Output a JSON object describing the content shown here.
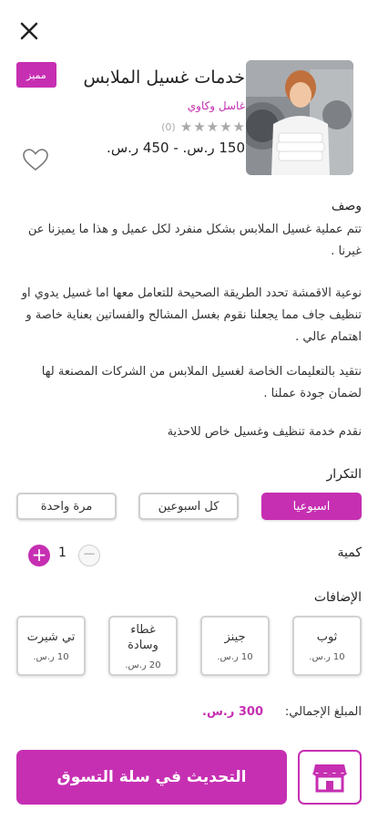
{
  "header": {
    "close_icon": "close-icon",
    "featured_badge": "مميز",
    "title": "خدمات غسيل الملابس",
    "provider": "غاسل وكاوي",
    "rating": {
      "value": 0,
      "max": 5,
      "count_label": "(0)"
    },
    "price_range": "150 ر.س. - 450 ر.س.",
    "favorite_icon": "heart-outline-icon"
  },
  "description": {
    "title": "وصف",
    "paragraphs": [
      "تتم عملية غسيل الملابس بشكل منفرد لكل عميل و هذا ما يميزنا عن غيرنا .",
      "نوعية الاقمشة تحدد الطريقة الصحيحة للتعامل معها اما غسيل يدوي او تنظيف جاف مما يجعلنا نقوم بغسل المشالح والفساتين بعناية خاصة و اهتمام عالي .",
      "نتقيد بالتعليمات الخاصة لغسيل الملابس من الشركات المصنعة لها لضمان جودة عملنا .",
      "نقدم خدمة تنظيف وغسيل خاص للاحذية"
    ]
  },
  "frequency": {
    "title": "التكرار",
    "options": [
      "اسبوعيا",
      "كل اسبوعين",
      "مرة واحدة"
    ],
    "selected": "اسبوعيا"
  },
  "quantity": {
    "title": "كمية",
    "value": "1",
    "plus": "+",
    "minus": "−"
  },
  "addons": {
    "title": "الإضافات",
    "items": [
      {
        "name": "ثوب",
        "price": "10 ر.س."
      },
      {
        "name": "جينز",
        "price": "10 ر.س."
      },
      {
        "name": "غطاء وسادة",
        "price": "20 ر.س."
      },
      {
        "name": "تي شيرت",
        "price": "10 ر.س."
      }
    ]
  },
  "total": {
    "label": "المبلغ الإجمالي:",
    "value": "300 ر.س."
  },
  "footer": {
    "cart_button": "التحديث في سلة التسوق",
    "store_icon": "store-icon"
  },
  "colors": {
    "accent": "#c62fb2",
    "star_inactive": "#a9a9a9"
  }
}
